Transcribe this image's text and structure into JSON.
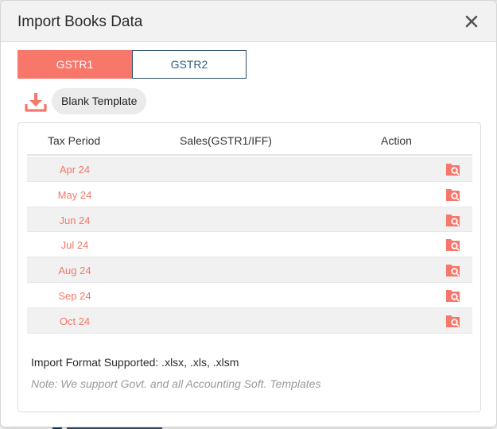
{
  "dialog": {
    "title": "Import Books Data"
  },
  "tabs": [
    {
      "label": "GSTR1",
      "active": true
    },
    {
      "label": "GSTR2",
      "active": false
    }
  ],
  "template": {
    "download_icon": "download-icon",
    "button_label": "Blank Template"
  },
  "table": {
    "headers": {
      "period": "Tax Period",
      "sales": "Sales(GSTR1/IFF)",
      "action": "Action"
    },
    "rows": [
      {
        "period": "Apr 24",
        "sales": "",
        "action_icon": "upload-file-icon"
      },
      {
        "period": "May 24",
        "sales": "",
        "action_icon": "upload-file-icon"
      },
      {
        "period": "Jun 24",
        "sales": "",
        "action_icon": "upload-file-icon"
      },
      {
        "period": "Jul 24",
        "sales": "",
        "action_icon": "upload-file-icon"
      },
      {
        "period": "Aug 24",
        "sales": "",
        "action_icon": "upload-file-icon"
      },
      {
        "period": "Sep 24",
        "sales": "",
        "action_icon": "upload-file-icon"
      },
      {
        "period": "Oct 24",
        "sales": "",
        "action_icon": "upload-file-icon"
      }
    ]
  },
  "footer": {
    "format_supported": "Import Format Supported: .xlsx, .xls, .xlsm",
    "note": "Note: We support Govt. and all Accounting Soft. Templates"
  },
  "colors": {
    "accent": "#f7776b",
    "period_text": "#f4776a",
    "tab_inactive_text": "#2b5d84",
    "header_bg": "#f2f2f2",
    "row_shade": "#f1f1f1"
  }
}
